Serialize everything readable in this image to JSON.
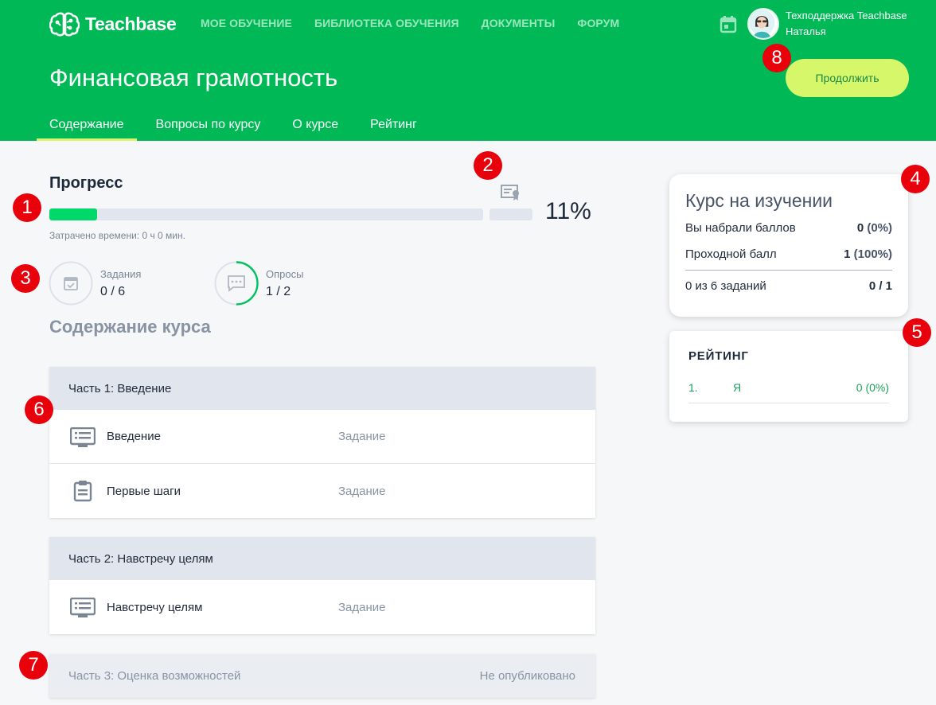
{
  "app": {
    "logo_text": "Teachbase"
  },
  "nav": [
    "МОЕ ОБУЧЕНИЕ",
    "БИБЛИОТЕКА ОБУЧЕНИЯ",
    "ДОКУМЕНТЫ",
    "ФОРУМ"
  ],
  "user": {
    "name": "Техподдержка Teachbase",
    "sub": "Наталья"
  },
  "course": {
    "title": "Финансовая грамотность",
    "continue_label": "Продолжить"
  },
  "tabs": [
    "Содержание",
    "Вопросы по курсу",
    "О курсе",
    "Рейтинг"
  ],
  "progress": {
    "title": "Прогресс",
    "percent_text": "11%",
    "fill_fraction": 0.11,
    "time_spent": "Затрачено времени: 0 ч 0 мин."
  },
  "stats": {
    "tasks_label": "Задания",
    "tasks_value": "0 / 6",
    "tasks_fraction": 0,
    "polls_label": "Опросы",
    "polls_value": "1 / 2",
    "polls_fraction": 0.5
  },
  "content_title": "Содержание курса",
  "sections": [
    {
      "title": "Часть 1: Введение",
      "items": [
        {
          "name": "Введение",
          "type": "Задание",
          "icon": "presentation-icon"
        },
        {
          "name": "Первые шаги",
          "type": "Задание",
          "icon": "clipboard-icon"
        }
      ]
    },
    {
      "title": "Часть 2: Навстречу целям",
      "items": [
        {
          "name": "Навстречу целям",
          "type": "Задание",
          "icon": "presentation-icon"
        }
      ]
    },
    {
      "title": "Часть 3: Оценка возможностей",
      "status": "Не опубликовано"
    }
  ],
  "status_card": {
    "title": "Курс на изучении",
    "score_label": "Вы набрали баллов",
    "score_value": "0",
    "score_pct": "(0%)",
    "pass_label": "Проходной балл",
    "pass_value": "1",
    "pass_pct": "(100%)",
    "tasks_label": "0 из 6 заданий",
    "tasks_value": "0 / 1"
  },
  "rating": {
    "title": "РЕЙТИНГ",
    "rows": [
      {
        "rank": "1.",
        "name": "Я",
        "score": "0 (0%)"
      }
    ]
  },
  "badges": [
    "1",
    "2",
    "3",
    "4",
    "5",
    "6",
    "7",
    "8"
  ],
  "colors": {
    "brand_green": "#00b956",
    "accent_lime": "#d7f76b",
    "progress_green": "#00d86a",
    "badge_red": "#e8000b"
  }
}
